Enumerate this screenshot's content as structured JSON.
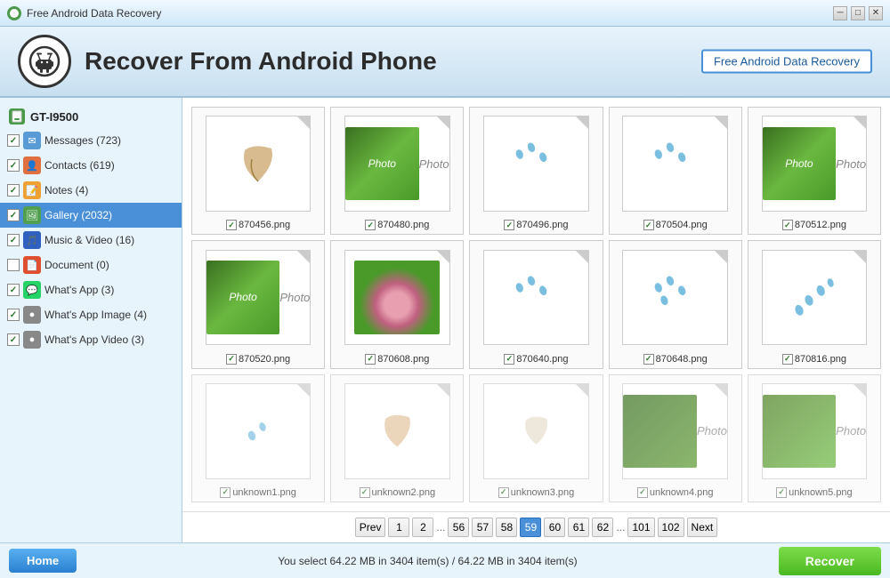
{
  "titleBar": {
    "title": "Free Android Data Recovery",
    "controls": [
      "minimize",
      "maximize",
      "close"
    ]
  },
  "header": {
    "title": "Recover From Android Phone",
    "badge": "Free Android Data Recovery"
  },
  "sidebar": {
    "deviceLabel": "GT-I9500",
    "items": [
      {
        "id": "messages",
        "label": "Messages",
        "count": "(723)",
        "checked": true,
        "iconClass": "icon-messages"
      },
      {
        "id": "contacts",
        "label": "Contacts",
        "count": "(619)",
        "checked": true,
        "iconClass": "icon-contacts"
      },
      {
        "id": "notes",
        "label": "Notes",
        "count": "(4)",
        "checked": true,
        "iconClass": "icon-notes"
      },
      {
        "id": "gallery",
        "label": "Gallery",
        "count": "(2032)",
        "checked": true,
        "iconClass": "icon-gallery",
        "active": true
      },
      {
        "id": "music",
        "label": "Music & Video",
        "count": "(16)",
        "checked": true,
        "iconClass": "icon-music"
      },
      {
        "id": "document",
        "label": "Document",
        "count": "(0)",
        "checked": false,
        "iconClass": "icon-document"
      },
      {
        "id": "whatsapp",
        "label": "What's App",
        "count": "(3)",
        "checked": true,
        "iconClass": "icon-whatsapp"
      },
      {
        "id": "whatsapp-image",
        "label": "What's App Image",
        "count": "(4)",
        "checked": true,
        "iconClass": "icon-whatsapp-img"
      },
      {
        "id": "whatsapp-video",
        "label": "What's App Video",
        "count": "(3)",
        "checked": true,
        "iconClass": "icon-whatsapp-vid"
      }
    ]
  },
  "gallery": {
    "items": [
      {
        "filename": "870456.png",
        "type": "leaf",
        "checked": true
      },
      {
        "filename": "870480.png",
        "type": "photo-leaves",
        "checked": true
      },
      {
        "filename": "870496.png",
        "type": "drops",
        "checked": true
      },
      {
        "filename": "870504.png",
        "type": "drops",
        "checked": true
      },
      {
        "filename": "870512.png",
        "type": "photo-leaves",
        "checked": true
      },
      {
        "filename": "870520.png",
        "type": "photo-leaves-large",
        "checked": true
      },
      {
        "filename": "870608.png",
        "type": "lotus",
        "checked": true
      },
      {
        "filename": "870640.png",
        "type": "drops",
        "checked": true
      },
      {
        "filename": "870648.png",
        "type": "drops-large",
        "checked": true
      },
      {
        "filename": "870816.png",
        "type": "drops-trail",
        "checked": true
      },
      {
        "filename": "unknown1.png",
        "type": "drops-sm",
        "checked": true,
        "partial": true
      },
      {
        "filename": "unknown2.png",
        "type": "leaf-sm",
        "checked": true,
        "partial": true
      },
      {
        "filename": "unknown3.png",
        "type": "leaf-faint",
        "checked": true,
        "partial": true
      },
      {
        "filename": "unknown4.png",
        "type": "photo-leaves-sm",
        "checked": true,
        "partial": true
      },
      {
        "filename": "unknown5.png",
        "type": "photo-leaves-sm2",
        "checked": true,
        "partial": true
      }
    ]
  },
  "pagination": {
    "prev": "Prev",
    "next": "Next",
    "pages": [
      "1",
      "2",
      "...",
      "56",
      "57",
      "58",
      "59",
      "60",
      "61",
      "62",
      "...",
      "101",
      "102"
    ],
    "activePage": "59"
  },
  "bottomBar": {
    "homeLabel": "Home",
    "statusText": "You select 64.22 MB in 3404 item(s) / 64.22 MB in 3404 item(s)",
    "recoverLabel": "Recover"
  }
}
